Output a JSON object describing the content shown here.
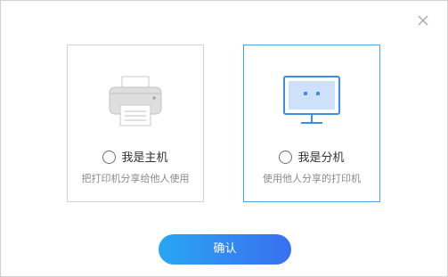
{
  "dialog": {
    "close_icon": "close-icon"
  },
  "options": [
    {
      "title": "我是主机",
      "description": "把打印机分享给他人使用",
      "icon": "printer-icon",
      "selected": false
    },
    {
      "title": "我是分机",
      "description": "使用他人分享的打印机",
      "icon": "monitor-icon",
      "selected": false,
      "highlighted": true
    }
  ],
  "confirm_label": "确认",
  "colors": {
    "accent_border": "#4ea0e6",
    "button_gradient_start": "#28a6f2",
    "button_gradient_end": "#3a6ff0",
    "monitor_screen": "#cfe0fb",
    "monitor_outline": "#3b8ee8",
    "printer_body": "#dcdcdc"
  }
}
